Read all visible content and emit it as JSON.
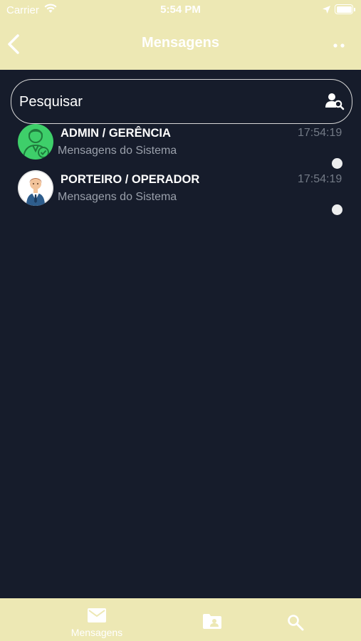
{
  "status_bar": {
    "carrier": "Carrier",
    "time": "5:54 PM"
  },
  "nav": {
    "title": "Mensagens"
  },
  "search": {
    "placeholder": "Pesquisar"
  },
  "conversations": [
    {
      "name": "ADMIN / GERÊNCIA",
      "subtitle": "Mensagens do Sistema",
      "time": "17:54:19",
      "unread": true,
      "avatar": "admin-avatar-icon"
    },
    {
      "name": "PORTEIRO / OPERADOR",
      "subtitle": "Mensagens do Sistema",
      "time": "17:54:19",
      "unread": true,
      "avatar": "doorman-avatar-icon"
    }
  ],
  "tab_bar": {
    "tabs": [
      {
        "label": "Mensagens",
        "icon": "mail-icon",
        "active": true
      },
      {
        "label": "",
        "icon": "contacts-folder-icon",
        "active": false
      },
      {
        "label": "",
        "icon": "search-icon",
        "active": false
      }
    ]
  },
  "colors": {
    "header_bg": "#ede8b4",
    "content_bg": "#161c2b",
    "admin_avatar_bg": "#3ecf6a",
    "unread_dot": "#ecedee"
  }
}
